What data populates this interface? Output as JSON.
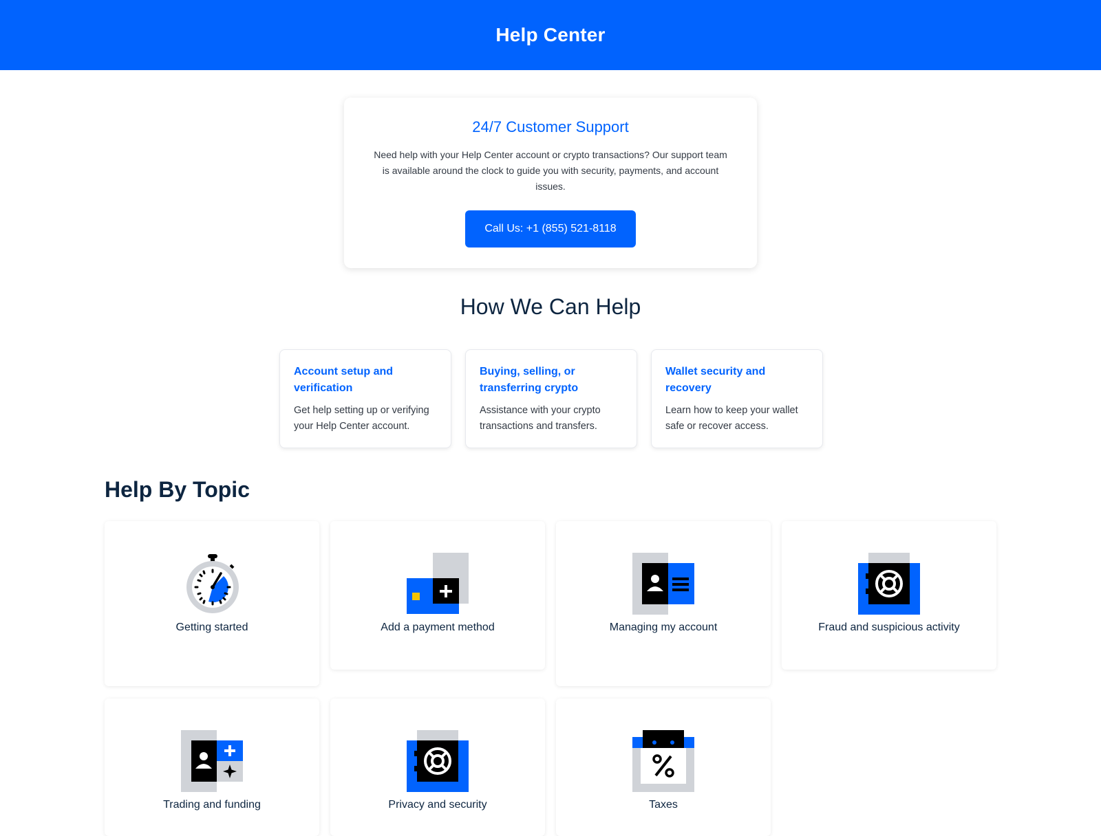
{
  "header": {
    "title": "Help Center"
  },
  "support": {
    "title": "24/7 Customer Support",
    "description": "Need help with your Help Center account or crypto transactions? Our support team is available around the clock to guide you with security, payments, and account issues.",
    "call_label": "Call Us: +1 (855) 521-8118"
  },
  "how_we_help": {
    "title": "How We Can Help",
    "cards": [
      {
        "title": "Account setup and verification",
        "text": "Get help setting up or verifying your Help Center account."
      },
      {
        "title": "Buying, selling, or transferring crypto",
        "text": "Assistance with your crypto transactions and transfers."
      },
      {
        "title": "Wallet security and recovery",
        "text": "Learn how to keep your wallet safe or recover access."
      }
    ]
  },
  "topics": {
    "title": "Help By Topic",
    "items": [
      {
        "label": "Getting started",
        "icon": "stopwatch-icon"
      },
      {
        "label": "Add a payment method",
        "icon": "payment-card-add-icon"
      },
      {
        "label": "Managing my account",
        "icon": "account-card-icon"
      },
      {
        "label": "Fraud and suspicious activity",
        "icon": "safe-vault-icon"
      },
      {
        "label": "Trading and funding",
        "icon": "trading-funding-icon"
      },
      {
        "label": "Privacy and security",
        "icon": "safe-vault-icon"
      },
      {
        "label": "Taxes",
        "icon": "tax-calendar-icon"
      }
    ]
  },
  "colors": {
    "brand": "#0163fe",
    "heading": "#0d2540",
    "icon_grey": "#d0d3d8",
    "accent_yellow": "#f5c400"
  }
}
